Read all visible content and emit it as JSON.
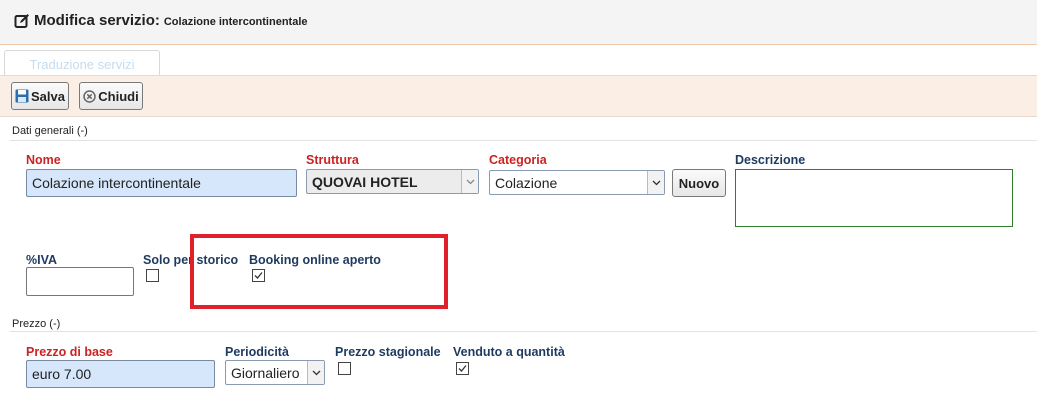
{
  "header": {
    "title": "Modifica servizio:",
    "subtitle": "Colazione intercontinentale"
  },
  "tabs": [
    {
      "label": "Traduzione servizi"
    }
  ],
  "toolbar": {
    "save_label": "Salva",
    "close_label": "Chiudi"
  },
  "sections": {
    "general": "Dati generali (-)",
    "price": "Prezzo (-)"
  },
  "fields": {
    "nome": {
      "label": "Nome",
      "value": "Colazione intercontinentale"
    },
    "struttura": {
      "label": "Struttura",
      "value": "QUOVAI HOTEL"
    },
    "categoria": {
      "label": "Categoria",
      "value": "Colazione",
      "new_label": "Nuovo"
    },
    "descrizione": {
      "label": "Descrizione",
      "value": ""
    },
    "iva": {
      "label": "%IVA",
      "value": ""
    },
    "solo_storico": {
      "label": "Solo per storico",
      "checked": false
    },
    "booking_online": {
      "label": "Booking online aperto",
      "checked": true
    },
    "prezzo_base": {
      "label": "Prezzo di base",
      "value": "euro 7.00"
    },
    "periodicita": {
      "label": "Periodicità",
      "value": "Giornaliero"
    },
    "prezzo_stagionale": {
      "label": "Prezzo stagionale",
      "checked": false
    },
    "venduto_quantita": {
      "label": "Venduto a quantità",
      "checked": true
    }
  },
  "colors": {
    "required_label": "#cc2222",
    "label": "#1e3a5f",
    "highlight": "#e0202a",
    "input_bg": "#d6e6fb",
    "toolbar_bg": "#fbeee4"
  }
}
